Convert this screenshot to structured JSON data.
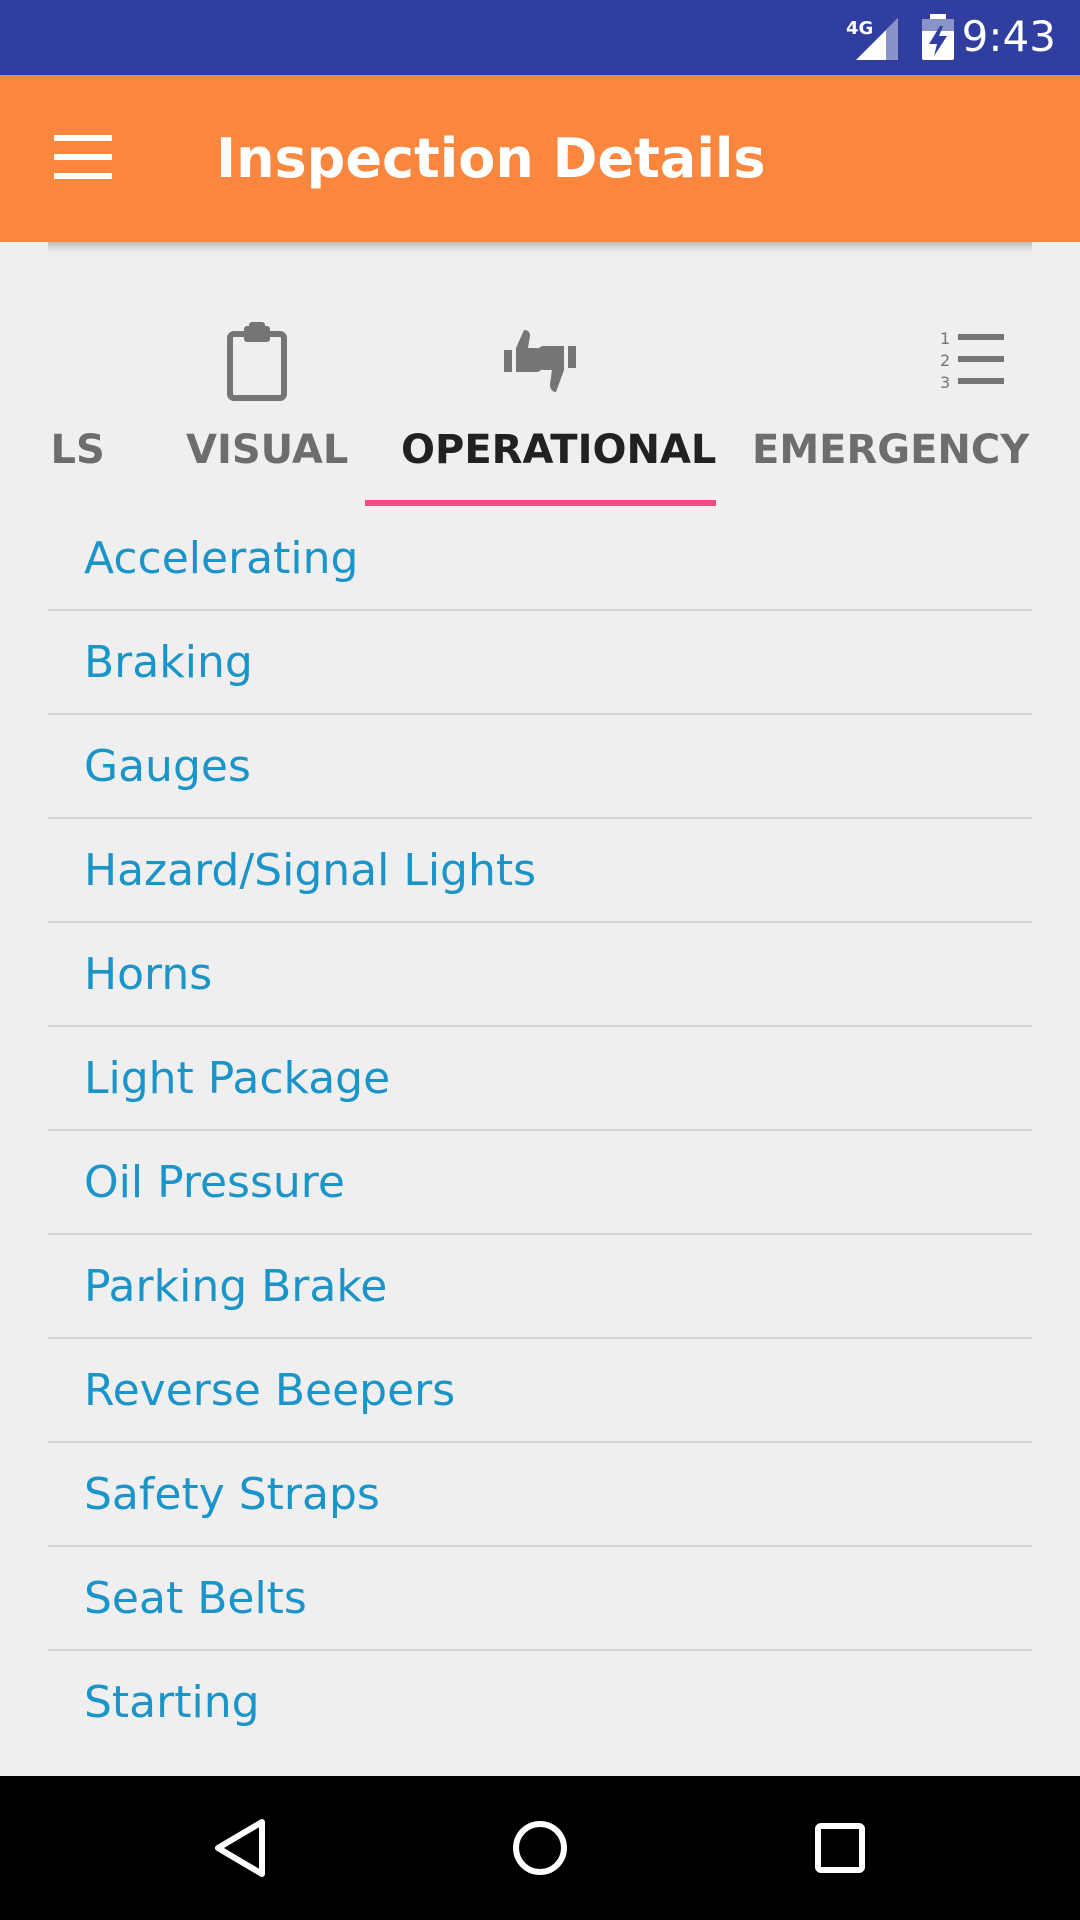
{
  "status_bar": {
    "time": "9:43",
    "network": "4G",
    "bg_color": "#303f9f"
  },
  "app_bar": {
    "title": "Inspection Details",
    "menu_icon": "hamburger-menu-icon",
    "bg_color": "#fb873e"
  },
  "tabs": [
    {
      "label": "DETAILS",
      "icon": "document-icon",
      "active": false
    },
    {
      "label": "VISUAL",
      "icon": "clipboard-icon",
      "active": false
    },
    {
      "label": "OPERATIONAL",
      "icon": "thumbs-up-down-icon",
      "active": true
    },
    {
      "label": "EMERGENCY S",
      "icon": "numbered-list-icon",
      "active": false
    }
  ],
  "tab_indicator_color": "#f24b86",
  "items": [
    "Accelerating",
    "Braking",
    "Gauges",
    "Hazard/Signal Lights",
    "Horns",
    "Light Package",
    "Oil Pressure",
    "Parking Brake",
    "Reverse Beepers",
    "Safety Straps",
    "Seat Belts",
    "Starting"
  ],
  "item_text_color": "#1b95c9",
  "nav_bar": {
    "back": "back-icon",
    "home": "home-icon",
    "recents": "recents-icon"
  }
}
